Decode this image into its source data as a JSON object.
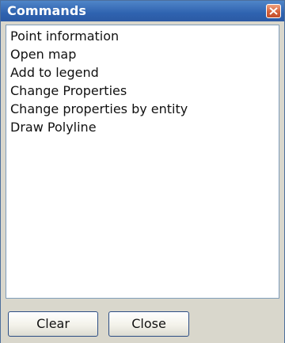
{
  "window": {
    "title": "Commands",
    "close_icon": "close-icon"
  },
  "commands": {
    "items": [
      {
        "label": "Point information"
      },
      {
        "label": "Open map"
      },
      {
        "label": "Add to legend"
      },
      {
        "label": "Change Properties"
      },
      {
        "label": "Change properties by entity"
      },
      {
        "label": "Draw Polyline"
      }
    ]
  },
  "footer": {
    "clear_label": "Clear",
    "close_label": "Close"
  },
  "colors": {
    "titlebar": "#2f63b0",
    "title_text": "#ffffff",
    "close_button": "#d6613a",
    "panel_background": "#d9d7cc",
    "list_background": "#ffffff",
    "list_border": "#7f9db9"
  }
}
